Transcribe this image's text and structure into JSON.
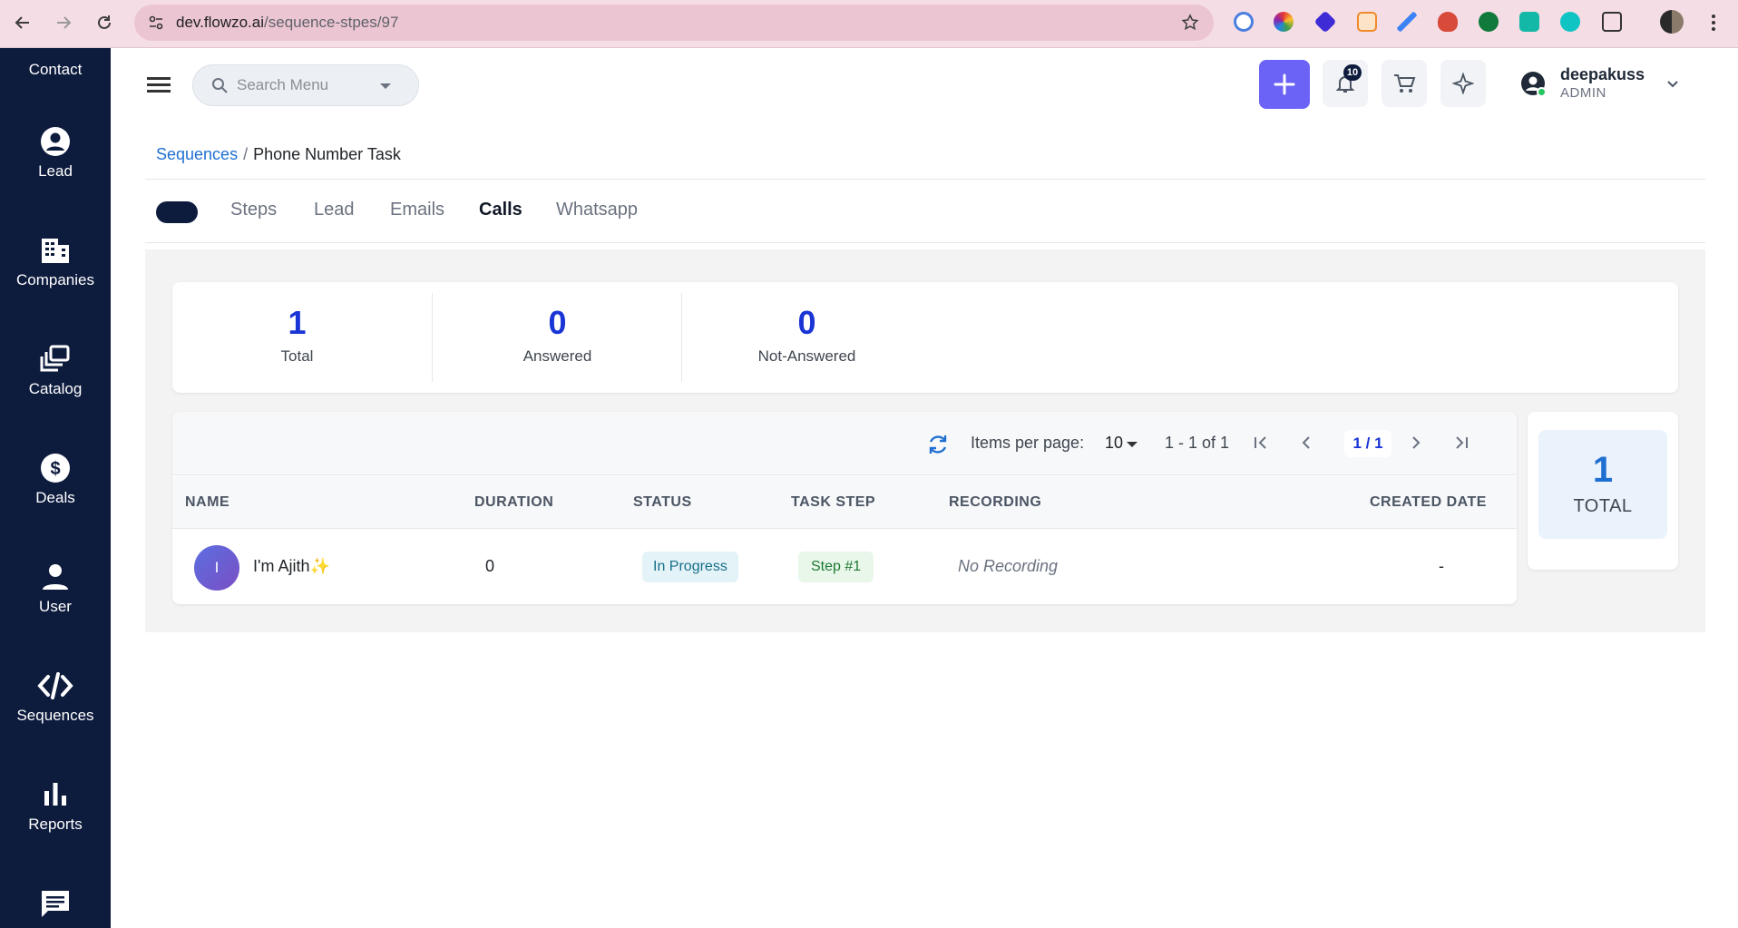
{
  "browser": {
    "url_host": "dev.flowzo.ai",
    "url_path": "/sequence-stpes/97"
  },
  "sidebar": {
    "items": [
      {
        "label": "Contact"
      },
      {
        "label": "Lead"
      },
      {
        "label": "Companies"
      },
      {
        "label": "Catalog"
      },
      {
        "label": "Deals"
      },
      {
        "label": "User"
      },
      {
        "label": "Sequences"
      },
      {
        "label": "Reports"
      }
    ]
  },
  "header": {
    "search_placeholder": "Search Menu",
    "notifications_count": "10",
    "user_name": "deepakuss",
    "user_role": "ADMIN"
  },
  "breadcrumb": {
    "parent": "Sequences",
    "separator": "/",
    "current": "Phone Number Task"
  },
  "tabs": [
    {
      "label": "Steps"
    },
    {
      "label": "Lead"
    },
    {
      "label": "Emails"
    },
    {
      "label": "Calls",
      "active": true
    },
    {
      "label": "Whatsapp"
    }
  ],
  "stats": [
    {
      "value": "1",
      "label": "Total"
    },
    {
      "value": "0",
      "label": "Answered"
    },
    {
      "value": "0",
      "label": "Not-Answered"
    }
  ],
  "pager": {
    "items_per_page_label": "Items per page:",
    "items_per_page": "10",
    "range": "1 - 1 of 1",
    "page": "1 / 1"
  },
  "table": {
    "columns": [
      "NAME",
      "DURATION",
      "STATUS",
      "TASK STEP",
      "RECORDING",
      "CREATED DATE"
    ],
    "rows": [
      {
        "avatar_initial": "I",
        "name": "I'm Ajith✨",
        "duration": "0",
        "status": "In Progress",
        "task_step": "Step #1",
        "recording": "No Recording",
        "created_date": "-"
      }
    ]
  },
  "total_card": {
    "value": "1",
    "label": "TOTAL"
  },
  "colors": {
    "sidebar_bg": "#0d1b3d",
    "accent": "#6b63f5",
    "stat_number": "#1a35d6",
    "link": "#1f6fd1"
  }
}
